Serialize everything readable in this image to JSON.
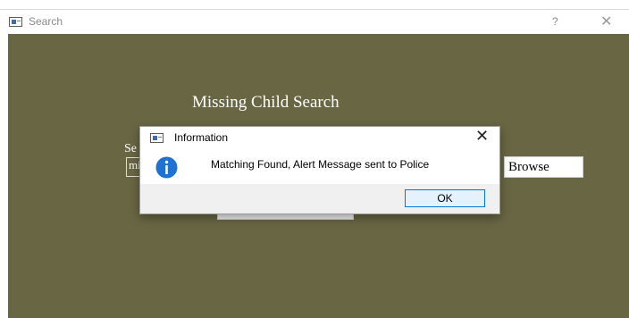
{
  "window": {
    "title": "Search",
    "help_label": "?",
    "close_label": "✕"
  },
  "main": {
    "heading": "Missing Child Search",
    "select_label": "Se",
    "path_value": "mi",
    "browse_label": "Browse"
  },
  "dialog": {
    "title": "Information",
    "close_label": "✕",
    "icon": "info-icon",
    "message": "Matching Found, Alert Message sent to Police",
    "ok_label": "OK"
  },
  "colors": {
    "background": "#686643",
    "accent": "#0078d7",
    "info_icon": "#1e73d2"
  }
}
